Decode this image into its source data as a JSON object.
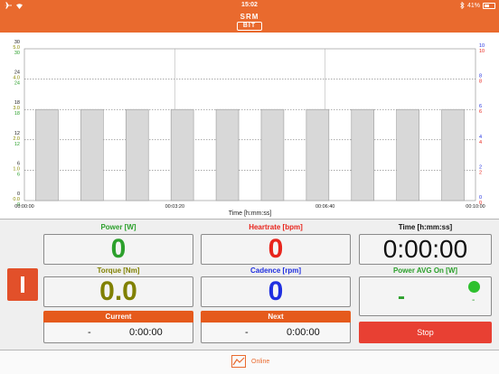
{
  "status_bar": {
    "time": "15:02",
    "battery_text": "41%",
    "battery_level": 0.41
  },
  "header": {
    "logo_line1": "SRM",
    "logo_line2": "BIT"
  },
  "colors": {
    "accent": "#e96a2e",
    "power": "#2ca02c",
    "torque": "#808000",
    "heartrate": "#e8251d",
    "cadence": "#1f2fe0",
    "stop": "#e84033",
    "segment_header": "#e55a1c"
  },
  "chart_data": {
    "type": "bar",
    "xlabel": "Time [h:mm:ss]",
    "x_ticks": [
      "00:00:00",
      "00:03:20",
      "00:06:40",
      "00:10:00"
    ],
    "x_tick_values_s": [
      0,
      200,
      400,
      600
    ],
    "xlim_s": [
      0,
      600
    ],
    "bars": [
      {
        "start_s": 15,
        "end_s": 45,
        "value": 18
      },
      {
        "start_s": 75,
        "end_s": 105,
        "value": 18
      },
      {
        "start_s": 135,
        "end_s": 165,
        "value": 18
      },
      {
        "start_s": 195,
        "end_s": 225,
        "value": 18
      },
      {
        "start_s": 255,
        "end_s": 285,
        "value": 18
      },
      {
        "start_s": 315,
        "end_s": 345,
        "value": 18
      },
      {
        "start_s": 375,
        "end_s": 405,
        "value": 18
      },
      {
        "start_s": 435,
        "end_s": 465,
        "value": 18
      },
      {
        "start_s": 495,
        "end_s": 525,
        "value": 18
      },
      {
        "start_s": 555,
        "end_s": 585,
        "value": 18
      }
    ],
    "ylim": [
      0,
      30
    ],
    "left_axes": [
      {
        "ticks": [
          "30",
          "24",
          "18",
          "12",
          "6",
          "0"
        ],
        "color": "#222222"
      },
      {
        "ticks": [
          "5.0",
          "4.0",
          "3.0",
          "2.0",
          "1.0",
          "0.0"
        ],
        "color": "#8a8a00"
      },
      {
        "ticks": [
          "30",
          "24",
          "18",
          "12",
          "6",
          "0"
        ],
        "color": "#2ca02c"
      }
    ],
    "right_axes": [
      {
        "ticks": [
          "10",
          "8",
          "6",
          "4",
          "2",
          "0"
        ],
        "color": "#1f2fe0"
      },
      {
        "ticks": [
          "10",
          "8",
          "6",
          "4",
          "2",
          "0"
        ],
        "color": "#e8251d"
      }
    ],
    "grid": true
  },
  "dashboard": {
    "power": {
      "label": "Power [W]",
      "value": "0"
    },
    "heartrate": {
      "label": "Heartrate [bpm]",
      "value": "0"
    },
    "time": {
      "label": "Time [h:mm:ss]",
      "value": "0:00:00"
    },
    "torque": {
      "label": "Torque [Nm]",
      "value": "0.0"
    },
    "cadence": {
      "label": "Cadence [rpm]",
      "value": "0"
    },
    "power_avg": {
      "label": "Power AVG On [W]",
      "value": "-",
      "small_value": "-"
    },
    "current": {
      "header": "Current",
      "value": "-",
      "time": "0:00:00"
    },
    "next": {
      "header": "Next",
      "value": "-",
      "time": "0:00:00"
    },
    "stop_label": "Stop"
  },
  "tabbar": {
    "online_label": "Online"
  }
}
